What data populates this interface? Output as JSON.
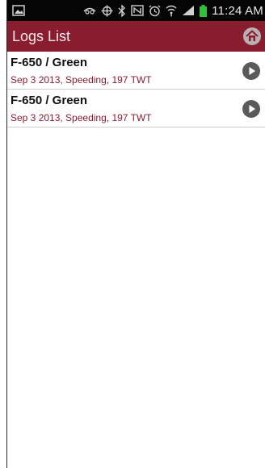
{
  "status_bar": {
    "time": "11:24 AM",
    "icons": [
      "image-icon",
      "eye-icon",
      "gps-icon",
      "bluetooth-icon",
      "nfc-icon",
      "alarm-icon",
      "wifi-icon",
      "signal-icon",
      "battery-icon"
    ],
    "battery_color": "#2fbf3a"
  },
  "action_bar": {
    "title": "Logs List",
    "action_icon": "home-icon",
    "background": "#8a1c30"
  },
  "logs": [
    {
      "title": "F-650 / Green",
      "subtitle": "Sep 3 2013, Speeding, 197 TWT",
      "action_icon": "play-icon"
    },
    {
      "title": "F-650 / Green",
      "subtitle": "Sep 3 2013, Speeding, 197 TWT",
      "action_icon": "play-icon"
    }
  ]
}
